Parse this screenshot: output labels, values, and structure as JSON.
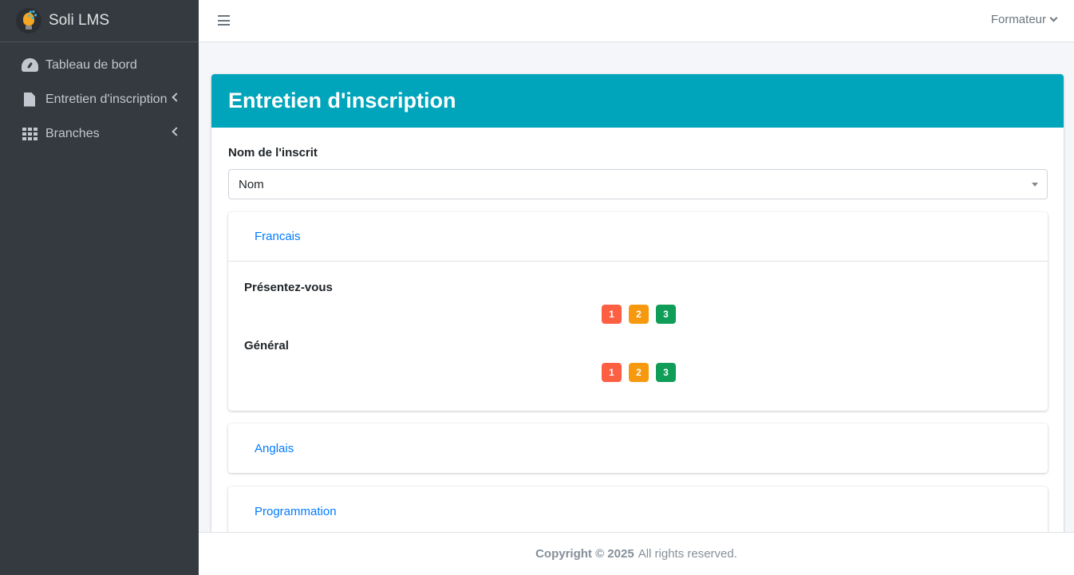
{
  "sidebar": {
    "brand": "Soli LMS",
    "items": [
      {
        "label": "Tableau de bord",
        "icon": "tachometer-icon"
      },
      {
        "label": "Entretien d'inscription",
        "icon": "file-icon"
      },
      {
        "label": "Branches",
        "icon": "th-grid-icon"
      }
    ]
  },
  "navbar": {
    "user": "Formateur"
  },
  "main": {
    "title": "Entretien d'inscription",
    "field_label": "Nom de l'inscrit",
    "select_value": "Nom",
    "sections": [
      {
        "name": "Francais",
        "questions": [
          {
            "label": "Présentez-vous",
            "ratings": [
              "1",
              "2",
              "3"
            ]
          },
          {
            "label": "Général",
            "ratings": [
              "1",
              "2",
              "3"
            ]
          }
        ]
      },
      {
        "name": "Anglais"
      },
      {
        "name": "Programmation"
      }
    ]
  },
  "footer": {
    "copyright": "Copyright © 2025",
    "rights": "All rights reserved."
  },
  "colors": {
    "sidebar": "#343a40",
    "header": "#00a5bb",
    "link": "#007bff",
    "rating_low": "#fd5f43",
    "rating_mid": "#f7990c",
    "rating_high": "#0f9d58"
  }
}
